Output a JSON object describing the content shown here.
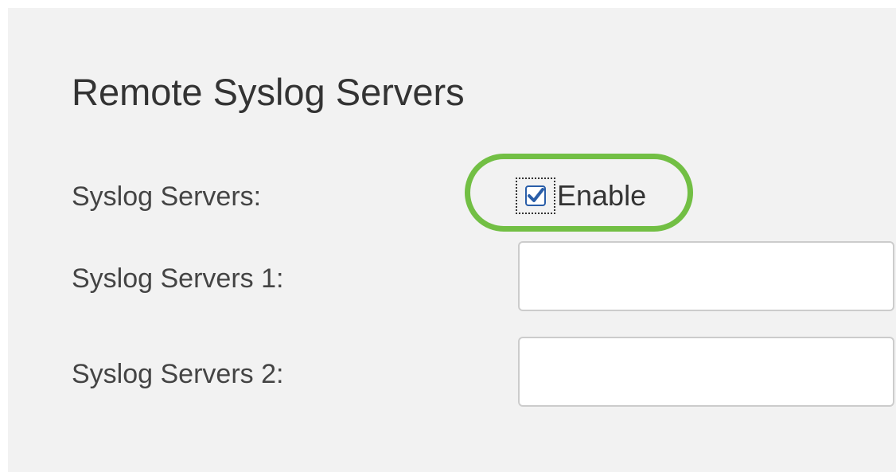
{
  "section": {
    "title": "Remote Syslog Servers"
  },
  "fields": {
    "enable_label": "Syslog Servers:",
    "enable_checkbox_label": "Enable",
    "enable_checked": true,
    "server1_label": "Syslog Servers 1:",
    "server1_value": "",
    "server2_label": "Syslog Servers 2:",
    "server2_value": ""
  },
  "colors": {
    "panel_background": "#f2f2f2",
    "highlight": "#72bf44",
    "checkmark": "#2a5ea8"
  },
  "icons": {
    "checkbox": "checkbox-checked-icon"
  }
}
